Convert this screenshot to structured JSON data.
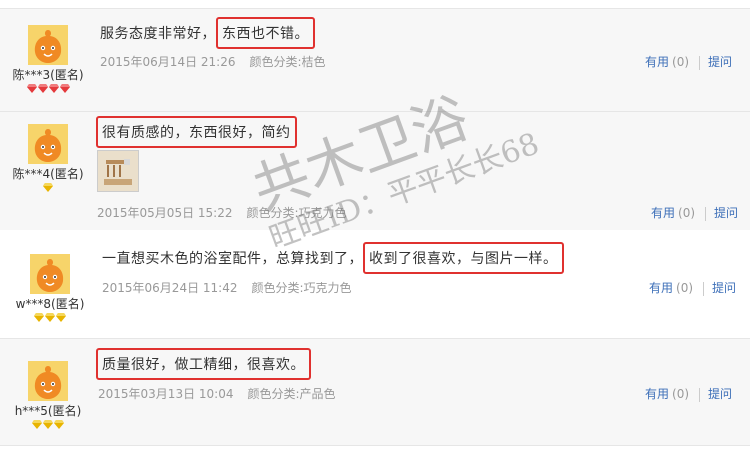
{
  "colors": {
    "link": "#3d6fb8",
    "highlight_border": "#e0312f",
    "muted": "#999999"
  },
  "icons": {
    "avatar": "orange-cartoon-avatar-icon",
    "red_badge": "red-diamond-icon",
    "gold_badge": "gold-diamond-icon"
  },
  "reviews": [
    {
      "user": "陈***3(匿名)",
      "badge_type": "red",
      "badge_count": 4,
      "text_plain": "服务态度非常好，",
      "text_highlight": "东西也不错。",
      "date": "2015年06月14日 21:26",
      "color_label": "颜色分类:桔色",
      "useful_label": "有用",
      "useful_count": "(0)",
      "ask_label": "提问"
    },
    {
      "user": "陈***4(匿名)",
      "badge_type": "gold",
      "badge_count": 1,
      "text_plain": "",
      "text_highlight": "很有质感的，东西很好，简约",
      "has_photo": true,
      "date": "2015年05月05日 15:22",
      "color_label": "颜色分类:巧克力色",
      "useful_label": "有用",
      "useful_count": "(0)",
      "ask_label": "提问"
    },
    {
      "user": "w***8(匿名)",
      "badge_type": "gold",
      "badge_count": 3,
      "text_plain": "一直想买木色的浴室配件，总算找到了，",
      "text_highlight": "收到了很喜欢，与图片一样。",
      "date": "2015年06月24日 11:42",
      "color_label": "颜色分类:巧克力色",
      "useful_label": "有用",
      "useful_count": "(0)",
      "ask_label": "提问"
    },
    {
      "user": "h***5(匿名)",
      "badge_type": "gold",
      "badge_count": 3,
      "text_plain": "",
      "text_highlight": "质量很好，做工精细，很喜欢。",
      "date": "2015年03月13日 10:04",
      "color_label": "颜色分类:产品色",
      "useful_label": "有用",
      "useful_count": "(0)",
      "ask_label": "提问"
    }
  ],
  "watermark": {
    "line1": "共木卫浴",
    "line2": "旺旺ID：平平长长68"
  }
}
